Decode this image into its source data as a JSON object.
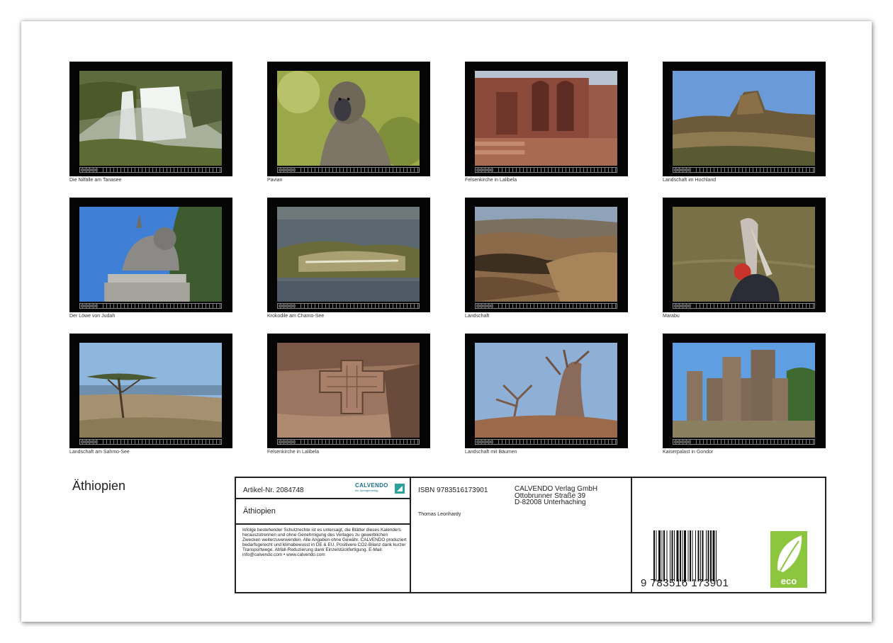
{
  "photos": [
    {
      "caption": "Die Nilfälle am Tanasee",
      "icon": "waterfall-photo"
    },
    {
      "caption": "Pavian",
      "icon": "baboon-photo"
    },
    {
      "caption": "Felsenkirche in Lalibela",
      "icon": "rock-church-photo"
    },
    {
      "caption": "Landschaft im Hochland",
      "icon": "highland-photo"
    },
    {
      "caption": "Der Löwe von Judah",
      "icon": "lion-statue-photo"
    },
    {
      "caption": "Krokodile am Chamo-See",
      "icon": "crocodile-photo"
    },
    {
      "caption": "Landschaft",
      "icon": "canyon-photo"
    },
    {
      "caption": "Marabu",
      "icon": "marabou-photo"
    },
    {
      "caption": "Landschaft am Sahmo-See",
      "icon": "acacia-photo"
    },
    {
      "caption": "Felsenkirche in Lalibela",
      "icon": "cross-church-photo"
    },
    {
      "caption": "Landschaft mit Bäumen",
      "icon": "baobab-photo"
    },
    {
      "caption": "Kaiserpalast in Gondor",
      "icon": "castle-photo"
    }
  ],
  "title": "Äthiopien",
  "info": {
    "artikel": "Artikel-Nr. 2084748",
    "brand": "CALVENDO",
    "brand_sub": "ein Springerverlag",
    "title": "Äthiopien",
    "legal": "Infolge bestehender Schutzrechte ist es untersagt, die Blätter dieses Kalenders herauszutrennen und ohne Genehmigung des Verlages zu gewerblichen Zwecken weiterzuverwenden. Alle Angaben ohne Gewähr. CALVENDO produziert bedarfsgerecht und klimabewusst in DE & EU. Positivere CO2-Bilanz dank kurzer Transportwege. Abfall-Reduzierung dank Einzelstückfertigung. E-Mail: info@calvendo.com • www.calvendo.com",
    "isbn": "ISBN 9783516173901",
    "author": "Thomas Leonhardy",
    "publisher_line1": "CALVENDO Verlag GmbH",
    "publisher_line2": "Ottobrunner Straße 39",
    "publisher_line3": "D-82008 Unterhaching",
    "barcode_digits": "9 783516 173901",
    "eco_label": "eco"
  }
}
